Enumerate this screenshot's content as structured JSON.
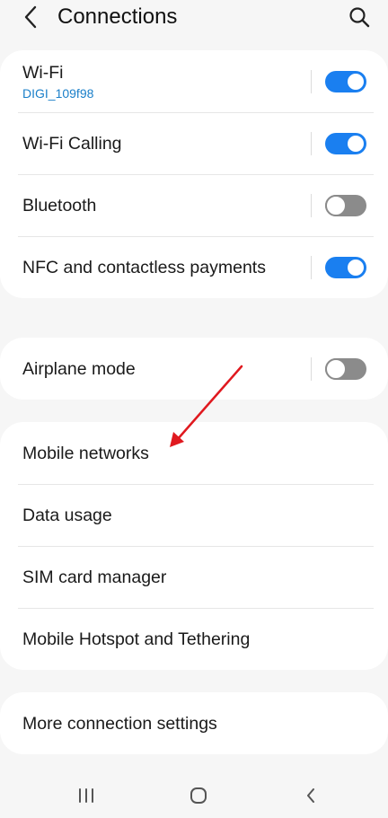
{
  "header": {
    "title": "Connections",
    "back_icon": "chevron-left-icon",
    "search_icon": "search-icon"
  },
  "colors": {
    "accent": "#1a7ff0",
    "link_sub": "#1a7fc9",
    "toggle_off": "#8b8b8b",
    "annotation_arrow": "#e0191f"
  },
  "groups": [
    {
      "items": [
        {
          "label": "Wi-Fi",
          "sub": "DIGI_109f98",
          "toggle": "on"
        },
        {
          "label": "Wi-Fi Calling",
          "toggle": "on"
        },
        {
          "label": "Bluetooth",
          "toggle": "off"
        },
        {
          "label": "NFC and contactless payments",
          "toggle": "on"
        }
      ]
    },
    {
      "items": [
        {
          "label": "Airplane mode",
          "toggle": "off"
        }
      ]
    },
    {
      "items": [
        {
          "label": "Mobile networks"
        },
        {
          "label": "Data usage"
        },
        {
          "label": "SIM card manager"
        },
        {
          "label": "Mobile Hotspot and Tethering"
        }
      ]
    },
    {
      "items": [
        {
          "label": "More connection settings"
        }
      ]
    }
  ],
  "nav": {
    "recents_icon": "recents-icon",
    "home_icon": "home-icon",
    "back_icon": "back-icon"
  }
}
